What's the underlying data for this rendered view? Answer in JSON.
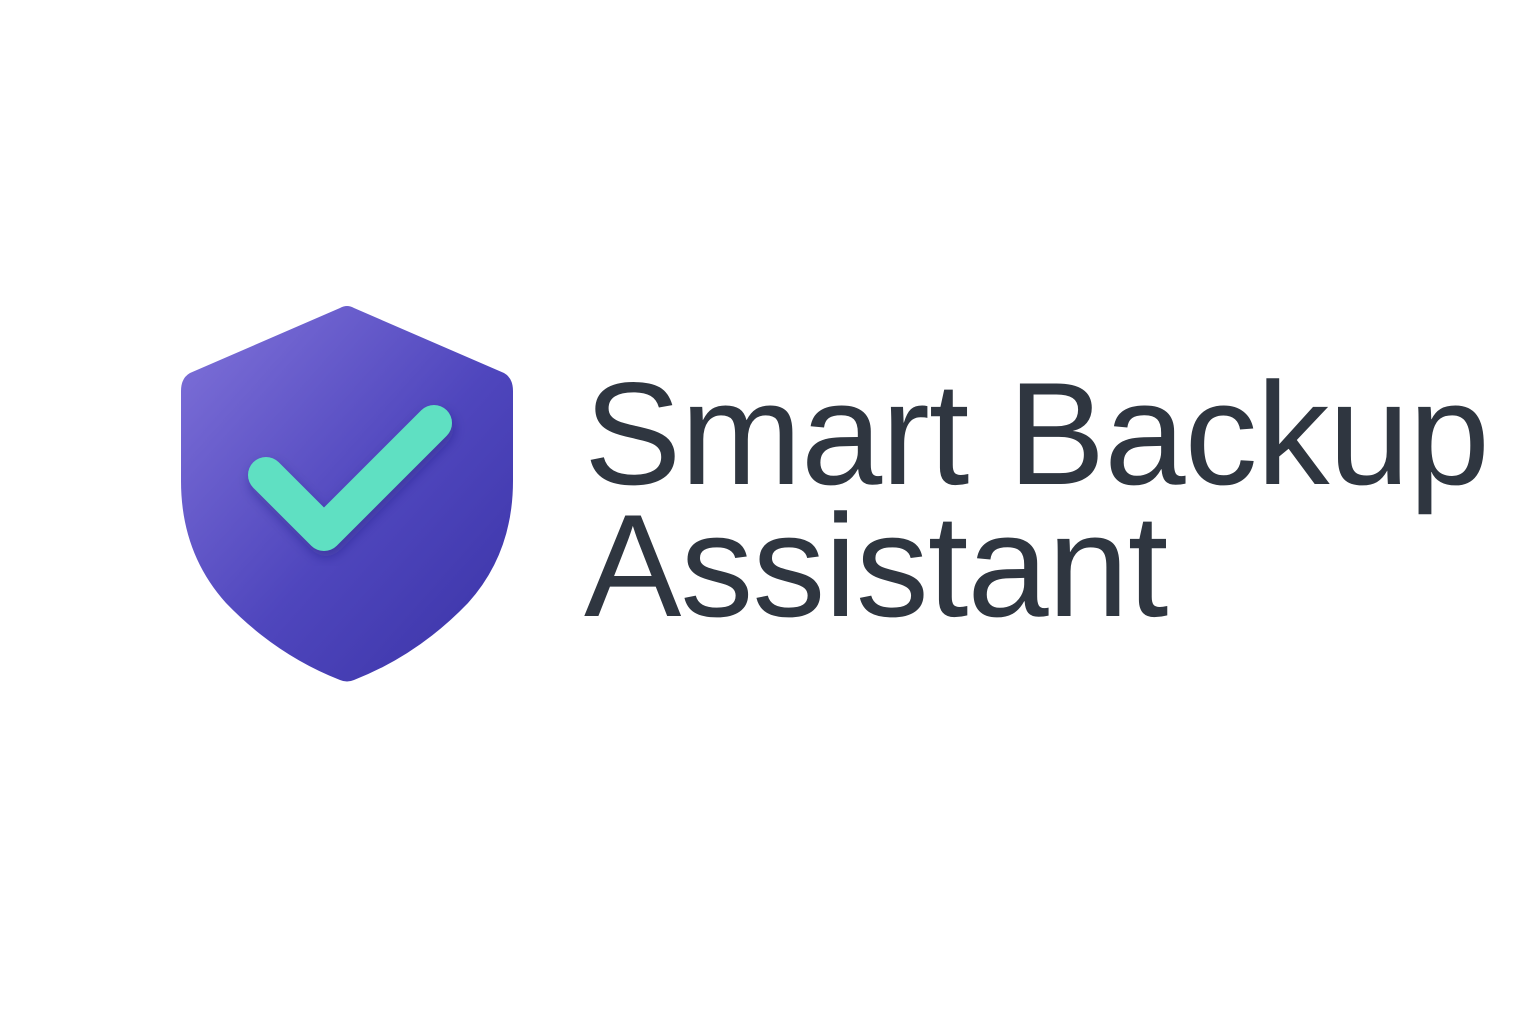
{
  "brand": {
    "name_line_1": "Smart Backup",
    "name_line_2": "Assistant",
    "logo_icon": "shield-check-icon",
    "colors": {
      "shield_light": "#7b70d6",
      "shield_dark": "#3d36a8",
      "check": "#5ee0c2",
      "text": "#2f3640",
      "background": "#ffffff"
    }
  }
}
